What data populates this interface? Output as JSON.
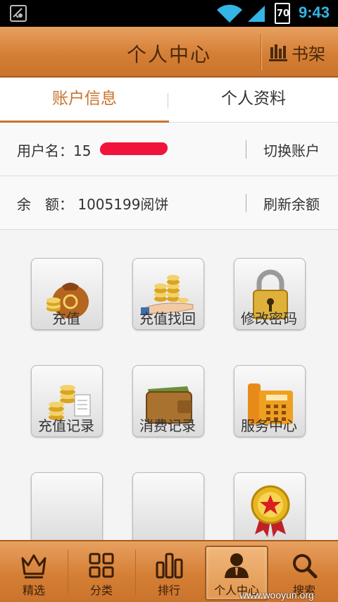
{
  "status_bar": {
    "battery": "70",
    "time": "9:43"
  },
  "header": {
    "title": "个人中心",
    "bookshelf_label": "书架"
  },
  "tabs": [
    {
      "label": "账户信息",
      "active": true
    },
    {
      "label": "个人资料",
      "active": false
    }
  ],
  "account": {
    "username_label": "用户名：15",
    "switch_label": "切换账户",
    "balance_label": "余　额：",
    "balance_value": "1005199阅饼",
    "refresh_label": "刷新余额"
  },
  "grid": [
    {
      "label": "充值",
      "icon": "money-bag-icon"
    },
    {
      "label": "充值找回",
      "icon": "coins-hand-icon"
    },
    {
      "label": "修改密码",
      "icon": "padlock-icon"
    },
    {
      "label": "充值记录",
      "icon": "coins-receipt-icon"
    },
    {
      "label": "消费记录",
      "icon": "wallet-icon"
    },
    {
      "label": "服务中心",
      "icon": "telephone-icon"
    },
    {
      "label": "",
      "icon": ""
    },
    {
      "label": "",
      "icon": ""
    },
    {
      "label": "",
      "icon": "award-medal-icon"
    }
  ],
  "bottom_nav": [
    {
      "label": "精选",
      "icon": "crown-icon",
      "active": false
    },
    {
      "label": "分类",
      "icon": "category-grid-icon",
      "active": false
    },
    {
      "label": "排行",
      "icon": "ranking-bars-icon",
      "active": false
    },
    {
      "label": "个人中心",
      "icon": "user-icon",
      "active": true
    },
    {
      "label": "搜索",
      "icon": "search-icon",
      "active": false
    }
  ],
  "watermark": "www.wooyun.org",
  "colors": {
    "brand_wood": "#d57f36",
    "active_tab": "#c9732c",
    "time": "#33b5e5",
    "redaction": "#f0143c"
  }
}
